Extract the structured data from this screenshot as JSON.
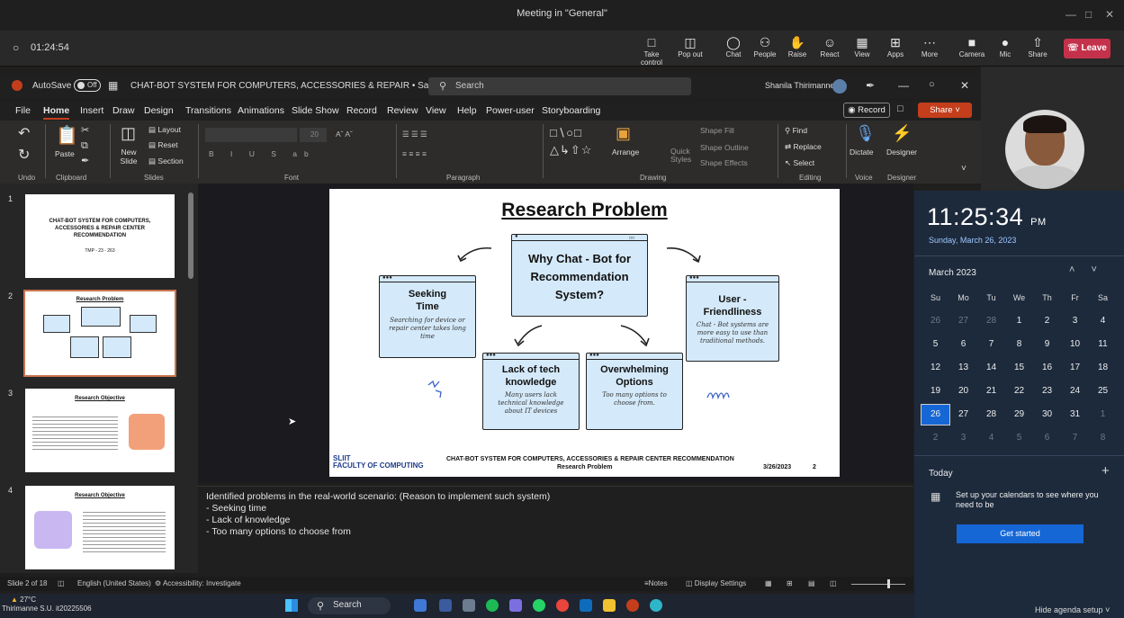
{
  "teams": {
    "title": "Meeting in \"General\"",
    "timer": "01:24:54",
    "buttons": [
      "Take control",
      "Pop out",
      "Chat",
      "People",
      "Raise",
      "React",
      "View",
      "Apps",
      "More",
      "Camera",
      "Mic",
      "Share"
    ],
    "leave": "Leave",
    "name_tag": "Thirimanne S.U. it20225506"
  },
  "ppt": {
    "autosave": "AutoSave",
    "autosave_state": "Off",
    "doc_title": "CHAT-BOT SYSTEM FOR COMPUTERS, ACCESSORIES & REPAIR • Saved to this PC ˅",
    "search": "Search",
    "user": "Shanila Thirimanne",
    "menu": [
      "File",
      "Home",
      "Insert",
      "Draw",
      "Design",
      "Transitions",
      "Animations",
      "Slide Show",
      "Record",
      "Review",
      "View",
      "Help",
      "Power-user",
      "Storyboarding"
    ],
    "record": "Record",
    "share": "Share",
    "ribbon": {
      "groups": [
        "Undo",
        "Clipboard",
        "Slides",
        "Font",
        "Paragraph",
        "Drawing",
        "Editing",
        "Voice",
        "Designer"
      ],
      "paste": "Paste",
      "new_slide": "New Slide",
      "layout": "Layout",
      "reset": "Reset",
      "section": "Section",
      "font_size": "20",
      "arrange": "Arrange",
      "quick_styles": "Quick Styles",
      "shape_fill": "Shape Fill",
      "shape_outline": "Shape Outline",
      "shape_effects": "Shape Effects",
      "find": "Find",
      "replace": "Replace",
      "select": "Select",
      "dictate": "Dictate",
      "designer": "Designer"
    },
    "thumbnails": [
      {
        "num": "1",
        "title": "CHAT-BOT SYSTEM FOR COMPUTERS, ACCESSORIES & REPAIR CENTER RECOMMENDATION",
        "sub": "TMP - 23 - 263"
      },
      {
        "num": "2",
        "title": "Research Problem"
      },
      {
        "num": "3",
        "title": "Research Objective"
      },
      {
        "num": "4",
        "title": "Research Objective"
      }
    ],
    "slide": {
      "title": "Research Problem",
      "center": "Why Chat - Bot for Recommendation System?",
      "cards": [
        {
          "title": "Seeking Time",
          "body": "Searching for device or repair center takes long time"
        },
        {
          "title": "User - Friendliness",
          "body": "Chat - Bot systems are more easy to use than traditional methods."
        },
        {
          "title": "Lack of tech knowledge",
          "body": "Many users lack technical knowledge about IT devices"
        },
        {
          "title": "Overwhelming Options",
          "body": "Too many options to choose from."
        }
      ],
      "logo_line1": "SLIIT",
      "logo_line2": "FACULTY OF COMPUTING",
      "footer_title": "CHAT-BOT SYSTEM FOR COMPUTERS, ACCESSORIES & REPAIR CENTER RECOMMENDATION",
      "footer_sub": "Research Problem",
      "date": "3/26/2023",
      "page": "2"
    },
    "notes": [
      "Identified problems in the real-world scenario: (Reason to implement such system)",
      "-   Seeking time",
      "-   Lack of knowledge",
      "-   Too many options to choose from"
    ],
    "status": {
      "slide": "Slide 2 of 18",
      "lang": "English (United States)",
      "access": "Accessibility: Investigate",
      "notes": "Notes",
      "display": "Display Settings"
    }
  },
  "clock": {
    "time": "11:25:34",
    "ampm": "PM",
    "date": "Sunday, March 26, 2023",
    "month": "March 2023",
    "weekdays": [
      "Su",
      "Mo",
      "Tu",
      "We",
      "Th",
      "Fr",
      "Sa"
    ],
    "weeks": [
      [
        "26",
        "27",
        "28",
        "1",
        "2",
        "3",
        "4"
      ],
      [
        "5",
        "6",
        "7",
        "8",
        "9",
        "10",
        "11"
      ],
      [
        "12",
        "13",
        "14",
        "15",
        "16",
        "17",
        "18"
      ],
      [
        "19",
        "20",
        "21",
        "22",
        "23",
        "24",
        "25"
      ],
      [
        "26",
        "27",
        "28",
        "29",
        "30",
        "31",
        "1"
      ],
      [
        "2",
        "3",
        "4",
        "5",
        "6",
        "7",
        "8"
      ]
    ],
    "today_label": "Today",
    "agenda": "Set up your calendars to see where you need to be",
    "get_started": "Get started",
    "hide_agenda": "Hide agenda setup"
  },
  "taskbar": {
    "temp": "27°C",
    "search": "Search"
  }
}
